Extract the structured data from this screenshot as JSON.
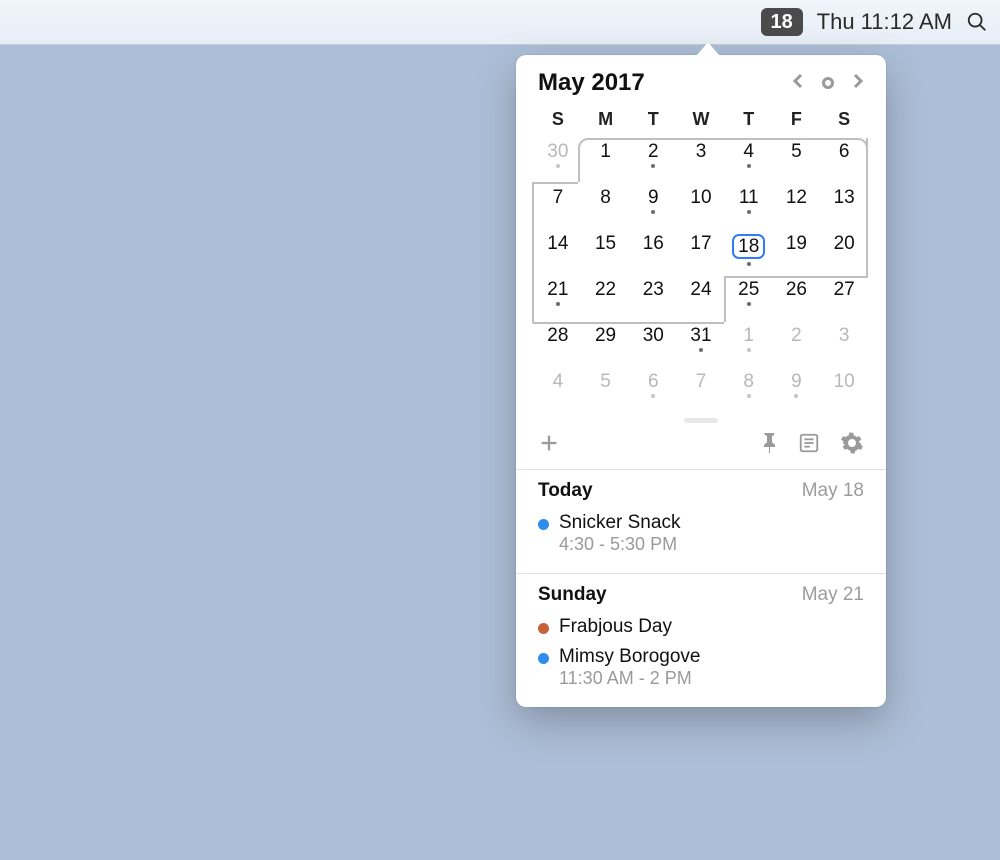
{
  "menubar": {
    "date_badge": "18",
    "clock": "Thu 11:12 AM"
  },
  "calendar": {
    "title": "May 2017",
    "weekday_labels": [
      "S",
      "M",
      "T",
      "W",
      "T",
      "F",
      "S"
    ],
    "cells": [
      {
        "n": "30",
        "outside": true,
        "dot": true
      },
      {
        "n": "1"
      },
      {
        "n": "2",
        "dot": true
      },
      {
        "n": "3"
      },
      {
        "n": "4",
        "dot": true
      },
      {
        "n": "5"
      },
      {
        "n": "6"
      },
      {
        "n": "7"
      },
      {
        "n": "8"
      },
      {
        "n": "9",
        "dot": true
      },
      {
        "n": "10"
      },
      {
        "n": "11",
        "dot": true
      },
      {
        "n": "12"
      },
      {
        "n": "13"
      },
      {
        "n": "14"
      },
      {
        "n": "15"
      },
      {
        "n": "16"
      },
      {
        "n": "17"
      },
      {
        "n": "18",
        "dot": true,
        "today": true
      },
      {
        "n": "19"
      },
      {
        "n": "20"
      },
      {
        "n": "21",
        "dot": true
      },
      {
        "n": "22"
      },
      {
        "n": "23"
      },
      {
        "n": "24"
      },
      {
        "n": "25",
        "dot": true
      },
      {
        "n": "26"
      },
      {
        "n": "27"
      },
      {
        "n": "28"
      },
      {
        "n": "29"
      },
      {
        "n": "30"
      },
      {
        "n": "31",
        "dot": true
      },
      {
        "n": "1",
        "outside": true,
        "dot": true
      },
      {
        "n": "2",
        "outside": true
      },
      {
        "n": "3",
        "outside": true
      },
      {
        "n": "4",
        "outside": true
      },
      {
        "n": "5",
        "outside": true
      },
      {
        "n": "6",
        "outside": true,
        "dot": true
      },
      {
        "n": "7",
        "outside": true
      },
      {
        "n": "8",
        "outside": true,
        "dot": true
      },
      {
        "n": "9",
        "outside": true,
        "dot": true
      },
      {
        "n": "10",
        "outside": true
      }
    ]
  },
  "colors": {
    "blue": "#2f8def",
    "orange": "#c5633d"
  },
  "agenda": {
    "sections": [
      {
        "title": "Today",
        "date": "May 18",
        "events": [
          {
            "title": "Snicker Snack",
            "time": "4:30 - 5:30 PM",
            "color": "blue"
          }
        ]
      },
      {
        "title": "Sunday",
        "date": "May 21",
        "events": [
          {
            "title": "Frabjous Day",
            "time": "",
            "color": "orange"
          },
          {
            "title": "Mimsy Borogove",
            "time": "11:30 AM - 2 PM",
            "color": "blue"
          }
        ]
      }
    ]
  }
}
